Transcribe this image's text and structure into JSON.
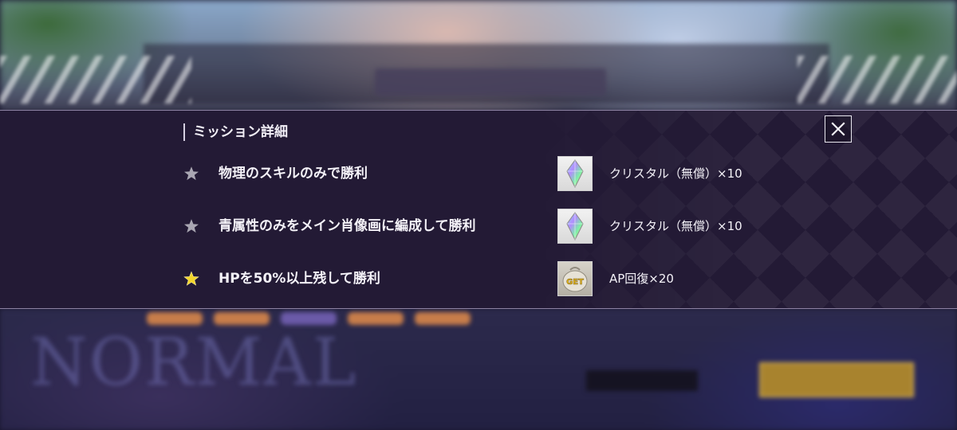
{
  "panel": {
    "title": "ミッション詳細",
    "close_icon": "close-icon"
  },
  "missions": [
    {
      "star": "star-icon",
      "achieved": false,
      "text": "物理のスキルのみで勝利",
      "reward_icon": "crystal-icon",
      "reward": "クリスタル（無償）×10"
    },
    {
      "star": "star-icon",
      "achieved": false,
      "text": "青属性のみをメイン肖像画に編成して勝利",
      "reward_icon": "crystal-icon",
      "reward": "クリスタル（無償）×10"
    },
    {
      "star": "star-icon",
      "achieved": true,
      "text": "HPを50%以上残して勝利",
      "reward_icon": "ap-recovery-icon",
      "reward_icon_label": "GET",
      "reward": "AP回復×20"
    }
  ],
  "colors": {
    "panel_bg": "#231a35",
    "star_inactive": "#a9a6b2",
    "star_achieved": "#f4d62a",
    "text": "#f4f2f8"
  }
}
